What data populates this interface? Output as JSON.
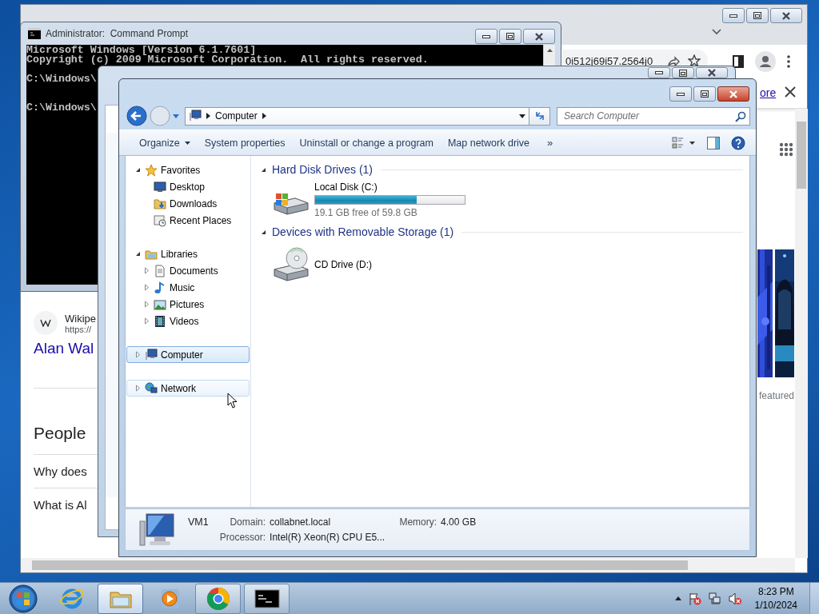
{
  "browser": {
    "active": false,
    "address_text": "0i512j69i57.2564j0",
    "banner_link": "ore",
    "result": {
      "site": "Wikipe",
      "url": "https://",
      "title": "Alan Wal"
    },
    "people_also_ask": {
      "heading": "People",
      "questions": [
        "Why does",
        "What is Al"
      ]
    },
    "image_caption": "featured"
  },
  "command_prompt": {
    "title": "Administrator:  Command Prompt",
    "active": false,
    "blocks": [
      [
        "Microsoft Windows [Version 6.1.7601]",
        "Copyright (c) 2009 Microsoft Corporation.  All rights reserved."
      ],
      [
        "C:\\Windows\\"
      ],
      [
        "C:\\Windows\\"
      ]
    ]
  },
  "background_window": {
    "active": false
  },
  "explorer": {
    "active": true,
    "breadcrumb": [
      "Computer"
    ],
    "search_placeholder": "Search Computer",
    "toolbar": [
      {
        "label": "Organize",
        "dropdown": true
      },
      {
        "label": "System properties",
        "dropdown": false
      },
      {
        "label": "Uninstall or change a program",
        "dropdown": false
      },
      {
        "label": "Map network drive",
        "dropdown": false
      }
    ],
    "toolbar_overflow": "»",
    "navigation_pane": [
      {
        "label": "Favorites",
        "kind": "favorites",
        "expanded": true,
        "selected": false,
        "hovered": false,
        "children": [
          {
            "label": "Desktop",
            "kind": "desktop",
            "selected": false
          },
          {
            "label": "Downloads",
            "kind": "downloads",
            "selected": false
          },
          {
            "label": "Recent Places",
            "kind": "recent",
            "selected": false
          }
        ]
      },
      {
        "label": "Libraries",
        "kind": "libraries",
        "expanded": true,
        "selected": false,
        "hovered": false,
        "children": [
          {
            "label": "Documents",
            "kind": "documents",
            "expanded": false,
            "selected": false
          },
          {
            "label": "Music",
            "kind": "music",
            "expanded": false,
            "selected": false
          },
          {
            "label": "Pictures",
            "kind": "pictures",
            "expanded": false,
            "selected": false
          },
          {
            "label": "Videos",
            "kind": "videos",
            "expanded": false,
            "selected": false
          }
        ]
      },
      {
        "label": "Computer",
        "kind": "computer",
        "expanded": false,
        "selected": true,
        "hovered": false
      },
      {
        "label": "Network",
        "kind": "network",
        "expanded": false,
        "selected": false,
        "hovered": true
      }
    ],
    "groups": [
      {
        "title": "Hard Disk Drives (1)",
        "expanded": true,
        "items": [
          {
            "kind": "disk",
            "name": "Local Disk (C:)",
            "level": 0.68,
            "space": "19.1 GB free of 59.8 GB"
          }
        ]
      },
      {
        "title": "Devices with Removable Storage (1)",
        "expanded": true,
        "items": [
          {
            "kind": "cd",
            "name": "CD Drive (D:)"
          }
        ]
      }
    ],
    "details": {
      "name": "VM1",
      "fields": [
        {
          "label": "Domain:",
          "value": "collabnet.local"
        },
        {
          "label": "Memory:",
          "value": "4.00 GB"
        },
        {
          "label": "Processor:",
          "value": "Intel(R) Xeon(R) CPU E5..."
        }
      ]
    }
  },
  "taskbar": {
    "items": [
      {
        "kind": "ie",
        "running": false,
        "selected": false
      },
      {
        "kind": "explorer",
        "running": true,
        "selected": true
      },
      {
        "kind": "media_player",
        "running": false,
        "selected": false
      },
      {
        "kind": "chrome",
        "running": true,
        "selected": false
      },
      {
        "kind": "cmd",
        "running": true,
        "selected": false
      }
    ],
    "clock": {
      "time": "8:23 PM",
      "date": "1/10/2024"
    }
  }
}
